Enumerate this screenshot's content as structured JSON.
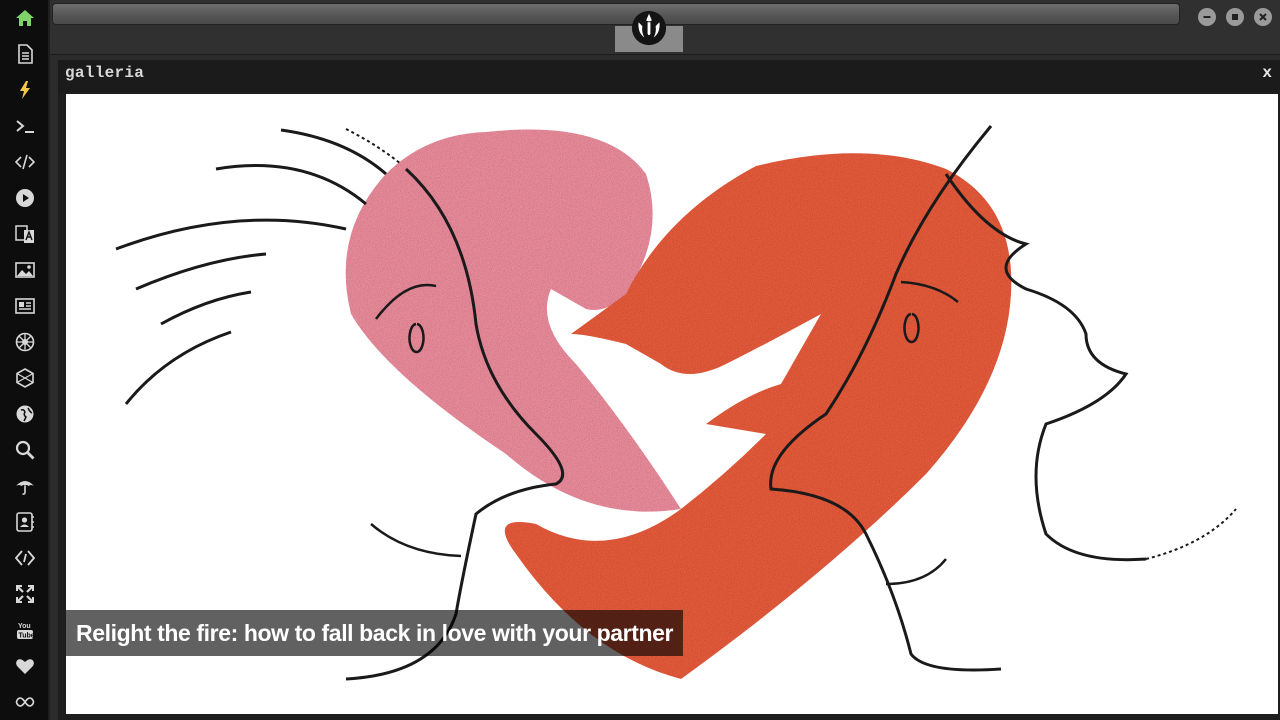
{
  "panel": {
    "title": "galleria",
    "close_label": "x"
  },
  "gallery": {
    "caption": "Relight the fire: how to fall back in love with your partner"
  },
  "sidebar": {
    "items": [
      {
        "icon": "home-icon",
        "active": true
      },
      {
        "icon": "document-icon"
      },
      {
        "icon": "lightning-icon"
      },
      {
        "icon": "terminal-icon"
      },
      {
        "icon": "code-icon"
      },
      {
        "icon": "play-icon"
      },
      {
        "icon": "translate-icon"
      },
      {
        "icon": "image-icon"
      },
      {
        "icon": "newspaper-icon"
      },
      {
        "icon": "empire-icon"
      },
      {
        "icon": "hexagon-icon"
      },
      {
        "icon": "globe-icon"
      },
      {
        "icon": "search-icon"
      },
      {
        "icon": "umbrella-icon"
      },
      {
        "icon": "contacts-icon"
      },
      {
        "icon": "diamond-code-icon"
      },
      {
        "icon": "expand-icon"
      },
      {
        "icon": "youtube-icon"
      },
      {
        "icon": "heart-icon"
      },
      {
        "icon": "infinity-icon"
      }
    ]
  },
  "colors": {
    "accent_active": "#7fd36a",
    "sidebar_bg": "#0d0d0d",
    "icon": "#d8d8d8",
    "heart_pink": "#e88a9a",
    "heart_red": "#e4593a"
  }
}
